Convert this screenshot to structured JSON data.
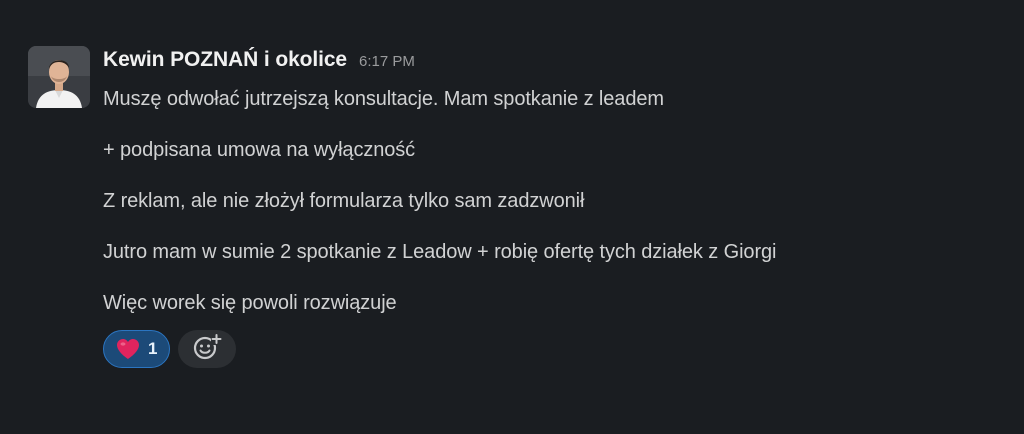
{
  "message": {
    "author": "Kewin POZNAŃ i okolice",
    "timestamp": "6:17 PM",
    "avatar_icon": "user-photo-avatar",
    "lines": [
      "Muszę odwołać jutrzejszą konsultacje. Mam spotkanie z leadem",
      "+ podpisana umowa na wyłączność",
      "Z reklam, ale nie złożył formularza tylko sam zadzwonił",
      "Jutro mam w sumie 2 spotkanie z Leadow + robię ofertę tych działek z Giorgi",
      "Więc worek się powoli rozwiązuje"
    ],
    "reactions": [
      {
        "emoji_icon": "red-heart-icon",
        "count": "1"
      }
    ],
    "add_reaction_icon": "add-emoji-icon"
  },
  "colors": {
    "background": "#1a1d21",
    "author_text": "#f1f1f1",
    "body_text": "#d1d2d3",
    "timestamp_text": "#9a9b9d",
    "reaction_bg": "#1c4a78",
    "reaction_border": "#2b75c1",
    "heart": "#e0245e"
  }
}
